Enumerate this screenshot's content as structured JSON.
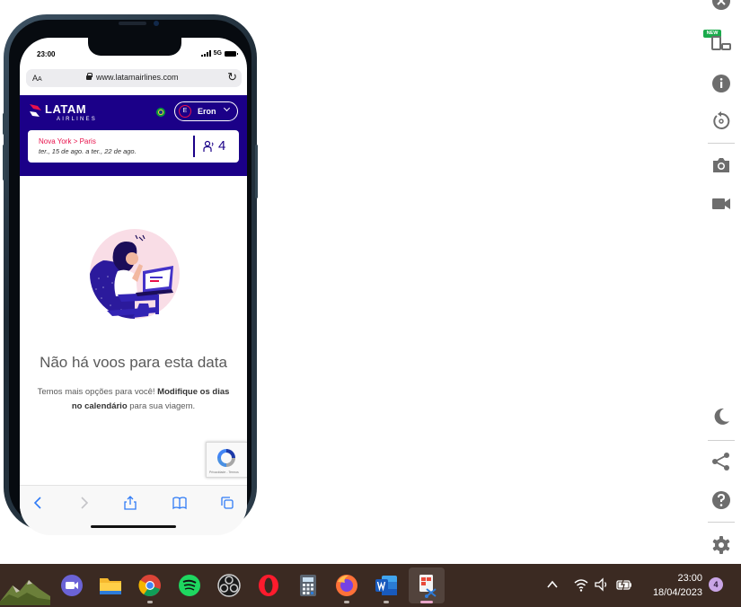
{
  "phone": {
    "status_time": "23:00",
    "network": "5G",
    "browser": {
      "aa_label": "AA",
      "url": "www.latamairlines.com"
    }
  },
  "latam": {
    "brand_name": "LATAM",
    "brand_sub": "AIRLINES",
    "user_name": "Eron",
    "user_initial": "E",
    "route": "Nova York > Paris",
    "dates": "ter., 15 de ago. a ter., 22 de ago.",
    "passengers": "4",
    "empty_title": "Não há voos para esta data",
    "msg_part1": "Temos mais opções para você! ",
    "msg_bold": "Modifique os dias no calendário",
    "msg_part2": " para sua viagem.",
    "recaptcha_text": "Privacidade - Termos"
  },
  "right_rail": {
    "new_badge": "NEW",
    "icons": [
      "close-icon",
      "device-mode-icon",
      "info-icon",
      "rotate-icon",
      "camera-icon",
      "video-icon",
      "moon-icon",
      "share-icon",
      "help-icon",
      "settings-icon"
    ]
  },
  "taskbar": {
    "apps": [
      "landscape-app",
      "video-call-app",
      "file-explorer-app",
      "chrome-app",
      "spotify-app",
      "obs-app",
      "opera-app",
      "calculator-app",
      "firefox-app",
      "word-app",
      "snipping-app"
    ],
    "time": "23:00",
    "date": "18/04/2023",
    "notification_count": "4"
  },
  "colors": {
    "latam_navy": "#1b0088",
    "latam_red": "#e8114b",
    "taskbar_bg": "#3b2a22",
    "badge_green": "#1aab4b"
  }
}
